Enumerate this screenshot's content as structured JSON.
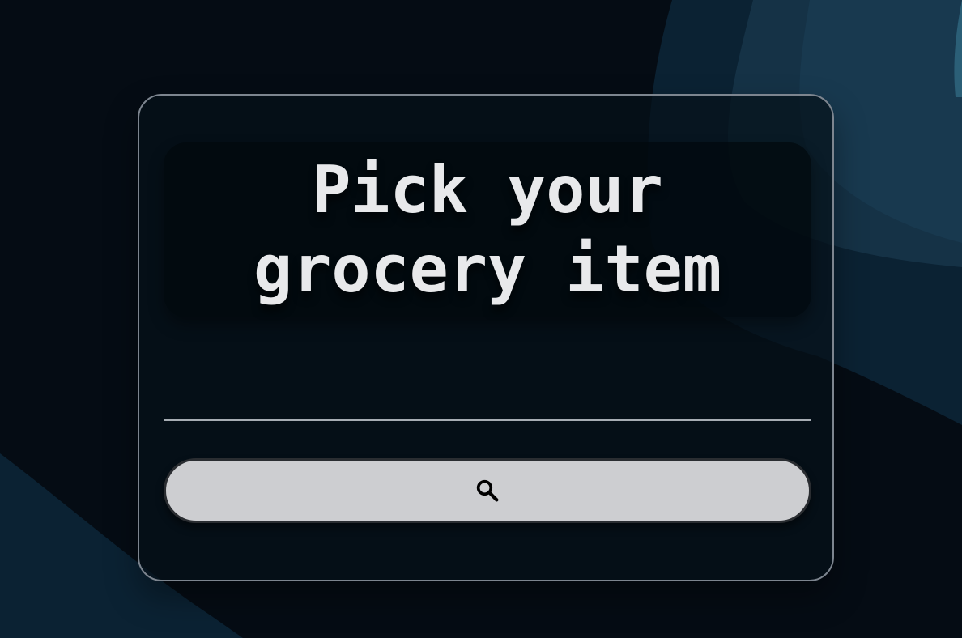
{
  "colors": {
    "background": "#050c14",
    "card_border": "#7d858f",
    "title_text": "#e8e9eb",
    "button_bg": "#cdced1"
  },
  "card": {
    "title": "Pick your\ngrocery item"
  },
  "search": {
    "value": "",
    "placeholder": ""
  },
  "search_button": {
    "icon": "search-icon"
  }
}
